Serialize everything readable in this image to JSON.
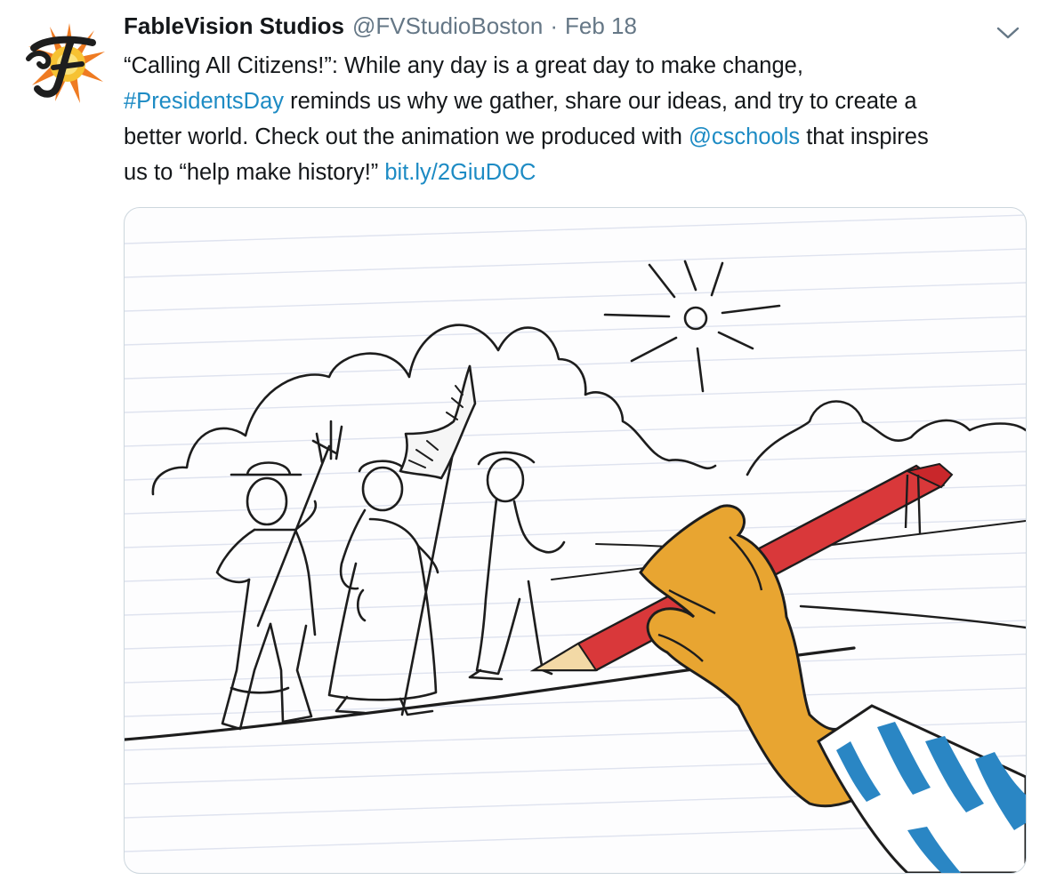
{
  "tweet": {
    "author_name": "FableVision Studios",
    "author_handle": "@FVStudioBoston",
    "separator": "·",
    "date": "Feb 18",
    "avatar_icon": "fablevision-logo-icon",
    "menu_icon": "chevron-down-icon",
    "text": {
      "line1": "“Calling All Citizens!”: While any day is a great day to make change,",
      "hashtag": "#PresidentsDay",
      "line2_rest": " reminds us why we gather, share our ideas, and try to create a",
      "line3_start": "better world. Check out the animation we produced with ",
      "mention": "@cschools",
      "line3_end": " that inspires",
      "line4_start": "us to “help make history!” ",
      "url": "bit.ly/2GiuDOC"
    },
    "colors": {
      "link": "#1d8bc4",
      "name": "#14171a",
      "muted": "#657786",
      "pencil": "#d9383a",
      "hand": "#e8a531",
      "sleeve_stripe": "#2a86c4"
    },
    "media": {
      "type": "animation-still",
      "description_icon": "drawing-hand-with-pencil-icon"
    }
  }
}
